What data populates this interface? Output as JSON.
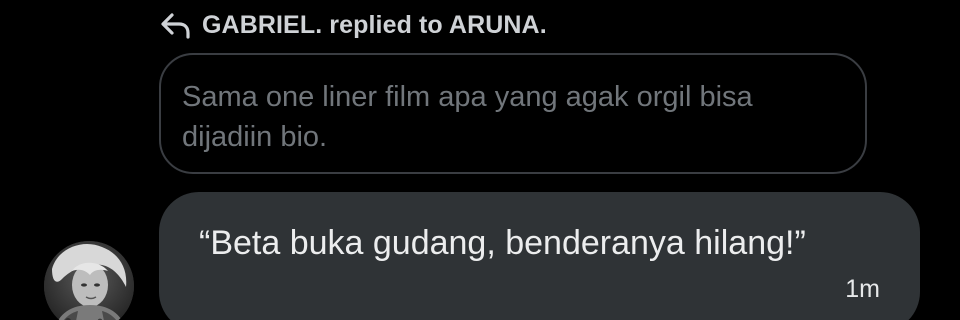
{
  "reply": {
    "icon": "reply-arrow-icon",
    "label": "GABRIEL. replied to ARUNA."
  },
  "quoted": {
    "text": "Sama one liner film apa yang agak orgil bisa dijadiin bio."
  },
  "message": {
    "text": "“Beta buka gudang, benderanya hilang!”",
    "time": "1m",
    "avatar_icon": "user-avatar-photo"
  },
  "colors": {
    "background": "#000000",
    "bubble": "#2f3336",
    "quoted_border": "#3a3d42",
    "quoted_text": "#71767b",
    "primary_text": "#e7e9ea"
  }
}
